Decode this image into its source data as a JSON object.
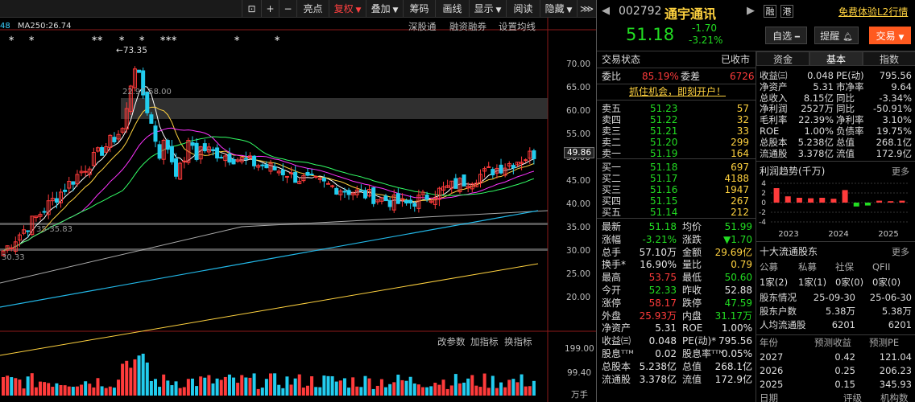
{
  "toolbar": {
    "buttons": [
      "亮点",
      "复权",
      "叠加",
      "筹码",
      "画线",
      "显示",
      "阅读",
      "隐藏"
    ],
    "active": "复权"
  },
  "ma_legend": {
    "left": "48",
    "ma250": "MA250:26.74"
  },
  "sub_tabs": {
    "deep": "深股通",
    "margin": "融资融券",
    "settings": "设置均线"
  },
  "price_axis": [
    "70.00",
    "65.00",
    "60.00",
    "55.00",
    "50.00",
    "45.00",
    "40.00",
    "35.00",
    "30.00",
    "25.00",
    "20.00"
  ],
  "current_price_tag": "49.86",
  "annotations": {
    "high": "73.35",
    "range": "22.97-58.00",
    "low_line": "35-35.83",
    "bottom_line": "30.33"
  },
  "indicator_tabs": {
    "change": "改参数",
    "add": "加指标",
    "switch": "换指标"
  },
  "volume_axis": [
    "199.00",
    "99.40",
    "万手"
  ],
  "stock": {
    "code": "002792",
    "name": "通宇通讯",
    "badge1": "融",
    "badge2": "港",
    "promo": "免费体验L2行情",
    "price": "51.18",
    "change": "-1.70",
    "change_pct": "-3.21%",
    "select_btn": "自选",
    "alert_btn": "提醒",
    "trade_btn": "交易"
  },
  "trade_status": {
    "label": "交易状态",
    "value": "已收市"
  },
  "ratio": {
    "label": "委比",
    "value": "85.19%",
    "diff_label": "委差",
    "diff": "6726"
  },
  "open_account": "抓住机会，即刻开户！",
  "asks": [
    {
      "label": "卖五",
      "price": "51.23",
      "vol": "57"
    },
    {
      "label": "卖四",
      "price": "51.22",
      "vol": "32"
    },
    {
      "label": "卖三",
      "price": "51.21",
      "vol": "33"
    },
    {
      "label": "卖二",
      "price": "51.20",
      "vol": "299"
    },
    {
      "label": "卖一",
      "price": "51.19",
      "vol": "164"
    }
  ],
  "bids": [
    {
      "label": "买一",
      "price": "51.18",
      "vol": "697"
    },
    {
      "label": "买二",
      "price": "51.17",
      "vol": "4188"
    },
    {
      "label": "买三",
      "price": "51.16",
      "vol": "1947"
    },
    {
      "label": "买四",
      "price": "51.15",
      "vol": "267"
    },
    {
      "label": "买五",
      "price": "51.14",
      "vol": "212"
    }
  ],
  "quote_stats": [
    {
      "l1": "最新",
      "v1": "51.18",
      "c1": "green",
      "l2": "均价",
      "v2": "51.99",
      "c2": "green"
    },
    {
      "l1": "涨幅",
      "v1": "-3.21%",
      "c1": "green",
      "l2": "涨跌",
      "v2": "▼1.70",
      "c2": "green"
    },
    {
      "l1": "总手",
      "v1": "57.10万",
      "c1": "white",
      "l2": "金额",
      "v2": "29.69亿",
      "c2": "yellow"
    },
    {
      "l1": "换手*",
      "v1": "16.90%",
      "c1": "white",
      "l2": "量比",
      "v2": "0.79",
      "c2": "yellow"
    },
    {
      "l1": "最高",
      "v1": "53.75",
      "c1": "red",
      "l2": "最低",
      "v2": "50.60",
      "c2": "green"
    },
    {
      "l1": "今开",
      "v1": "52.33",
      "c1": "green",
      "l2": "昨收",
      "v2": "52.88",
      "c2": "white"
    },
    {
      "l1": "涨停",
      "v1": "58.17",
      "c1": "red",
      "l2": "跌停",
      "v2": "47.59",
      "c2": "green"
    },
    {
      "l1": "外盘",
      "v1": "25.93万",
      "c1": "red",
      "l2": "内盘",
      "v2": "31.17万",
      "c2": "green"
    },
    {
      "l1": "净资产",
      "v1": "5.31",
      "c1": "white",
      "l2": "ROE",
      "v2": "1.00%",
      "c2": "white"
    },
    {
      "l1": "收益㈢",
      "v1": "0.048",
      "c1": "white",
      "l2": "PE(动)*",
      "v2": "795.56",
      "c2": "white"
    },
    {
      "l1": "股息ᵀᵀᴹ",
      "v1": "0.02",
      "c1": "white",
      "l2": "股息率ᵀᵀᴹ",
      "v2": "0.05%",
      "c2": "white"
    },
    {
      "l1": "总股本",
      "v1": "5.238亿",
      "c1": "white",
      "l2": "总值",
      "v2": "268.1亿",
      "c2": "white"
    },
    {
      "l1": "流通股",
      "v1": "3.378亿",
      "c1": "white",
      "l2": "流值",
      "v2": "172.9亿",
      "c2": "white"
    }
  ],
  "tabs": [
    "资金",
    "基本",
    "指数"
  ],
  "fundamentals": [
    {
      "l1": "收益㈢",
      "v1": "0.048",
      "l2": "PE(动)",
      "v2": "795.56",
      "c2": "white"
    },
    {
      "l1": "净资产",
      "v1": "5.31",
      "l2": "市净率",
      "v2": "9.64",
      "c2": "white"
    },
    {
      "l1": "总收入",
      "v1": "8.15亿",
      "l2": "同比",
      "v2": "-3.34%",
      "c2": "white"
    },
    {
      "l1": "净利润",
      "v1": "2527万",
      "l2": "同比",
      "v2": "-50.91%",
      "c2": "white"
    },
    {
      "l1": "毛利率",
      "v1": "22.39%",
      "l2": "净利率",
      "v2": "3.10%",
      "c2": "white"
    },
    {
      "l1": "ROE",
      "v1": "1.00%",
      "l2": "负债率",
      "v2": "19.75%",
      "c2": "white"
    },
    {
      "l1": "总股本",
      "v1": "5.238亿",
      "l2": "总值",
      "v2": "268.1亿",
      "c2": "white"
    },
    {
      "l1": "流通股",
      "v1": "3.378亿",
      "l2": "流值",
      "v2": "172.9亿",
      "c2": "white"
    }
  ],
  "profit_trend": {
    "title": "利润趋势(千万)",
    "more": "更多",
    "yticks": [
      "4",
      "2",
      "0",
      "-2",
      "-4"
    ],
    "years": [
      "2023",
      "2024",
      "2025"
    ]
  },
  "shareholders": {
    "title": "十大流通股东",
    "more": "更多",
    "cols": [
      "公募",
      "私募",
      "社保",
      "QFII"
    ],
    "counts": [
      "1家(2)",
      "1家(1)",
      "0家(0)",
      "0家(0)"
    ],
    "rows": [
      {
        "l": "股东情况",
        "a": "25-09-30",
        "b": "25-06-30"
      },
      {
        "l": "股东户数",
        "a": "5.38万",
        "b": "5.38万"
      },
      {
        "l": "人均流通股",
        "a": "6201",
        "b": "6201"
      }
    ]
  },
  "forecast": {
    "cols": [
      "年份",
      "预测收益",
      "预测PE"
    ],
    "rows": [
      {
        "y": "2027",
        "e": "0.42",
        "pe": "121.04"
      },
      {
        "y": "2026",
        "e": "0.25",
        "pe": "206.23"
      },
      {
        "y": "2025",
        "e": "0.15",
        "pe": "345.93"
      }
    ],
    "footer": [
      "日期",
      "评级",
      "机构数"
    ]
  },
  "colors": {
    "up": "#ff3b3b",
    "down": "#22dd22",
    "accent": "#ffd23f",
    "trade_btn": "#ff5a1f"
  }
}
